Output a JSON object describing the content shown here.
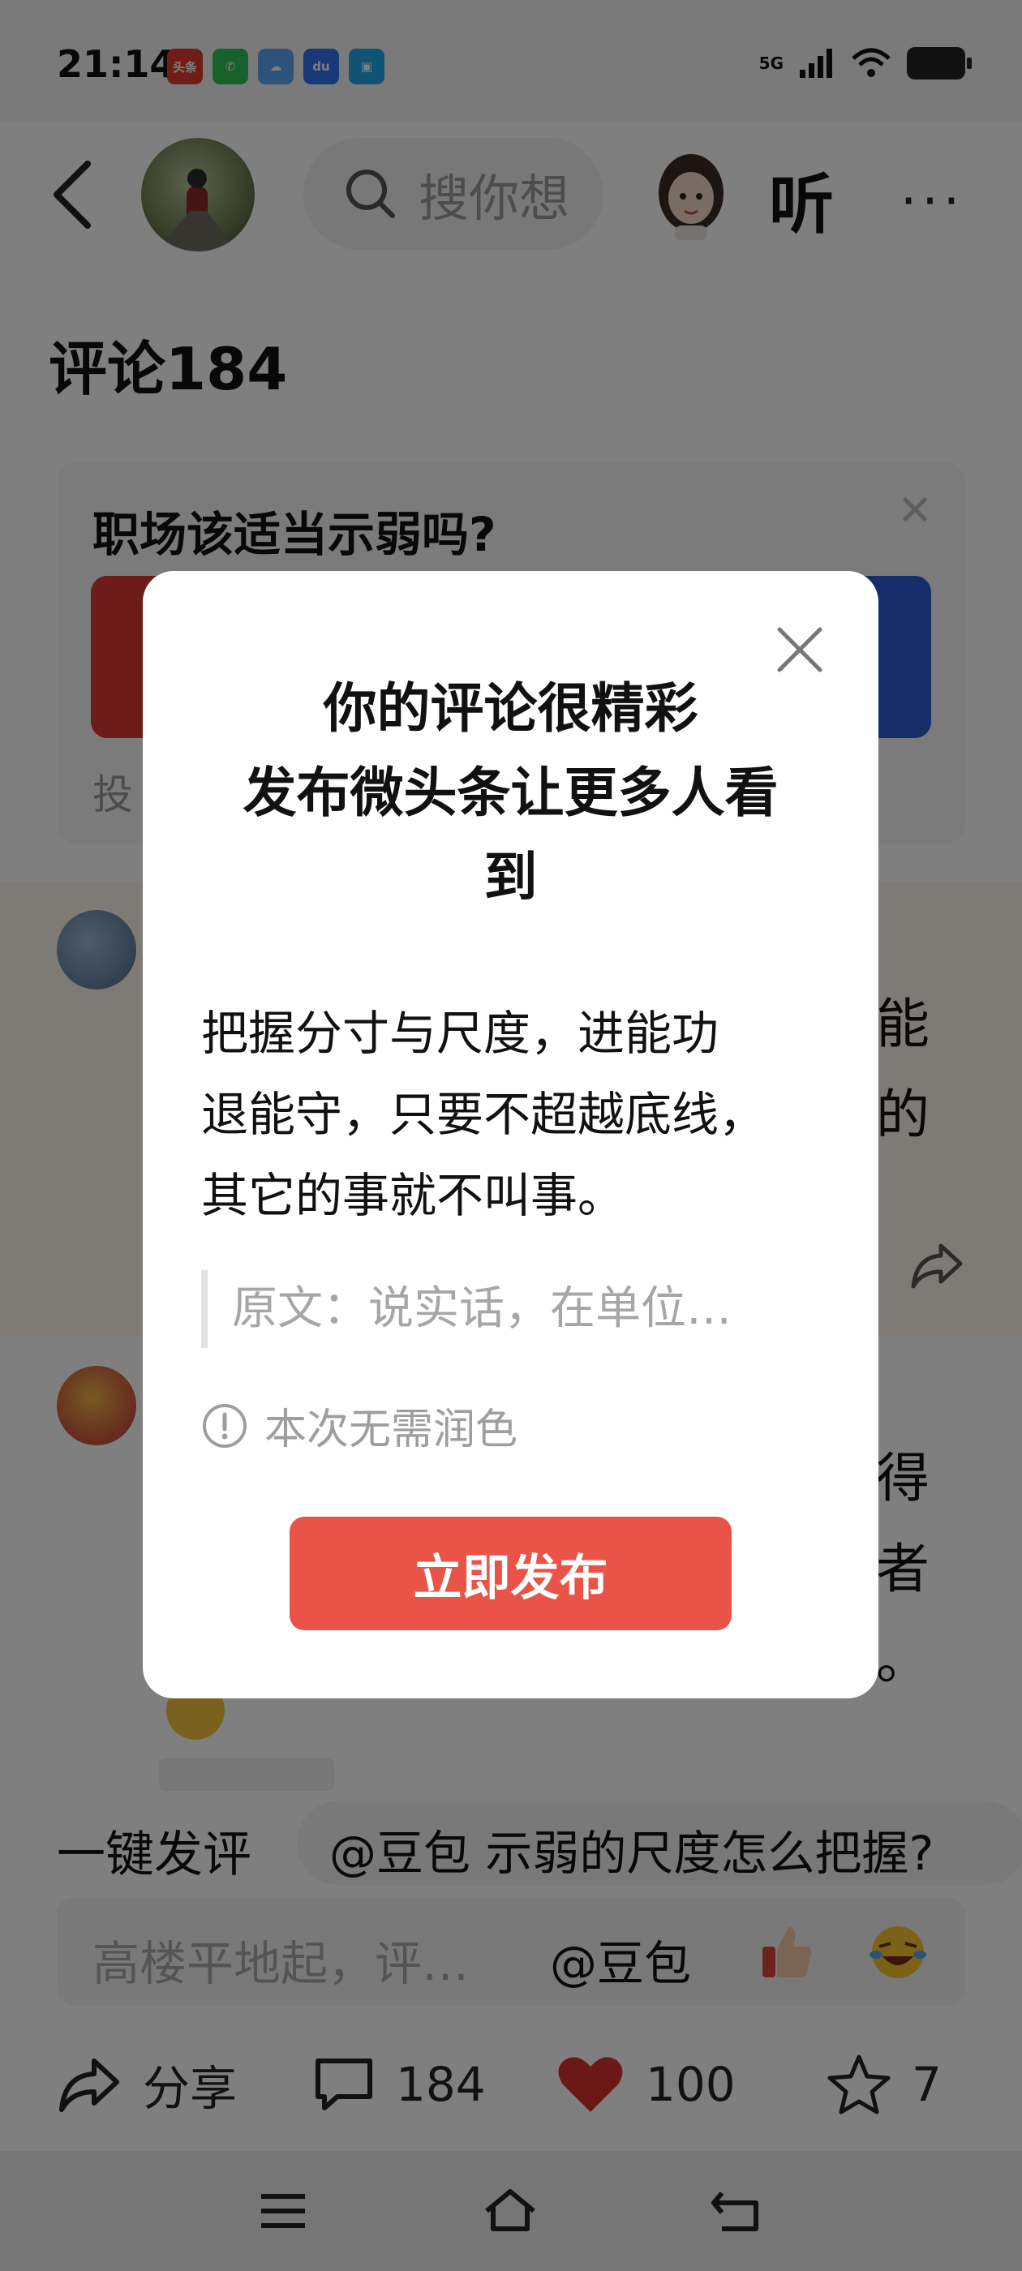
{
  "status_bar": {
    "time": "21:14",
    "network": "5G",
    "app_icons": [
      "toutiao",
      "phone",
      "weather",
      "baidu",
      "files"
    ],
    "toutiao_label": "头条"
  },
  "nav": {
    "search_placeholder": "搜你想",
    "listen_label": "听",
    "more_label": "···"
  },
  "page": {
    "title": "评论184"
  },
  "poll": {
    "title": "职场该适当示弱吗?",
    "footer_prefix": "投"
  },
  "comments": [
    {
      "visible_tail": [
        "能",
        "的"
      ]
    },
    {
      "visible_tail": [
        "得",
        "者",
        "。"
      ]
    }
  ],
  "bottom": {
    "quick_label": "一键发评",
    "quick_prompt": "@豆包 示弱的尺度怎么把握?",
    "composer_placeholder": "高楼平地起，评…",
    "composer_mention": "@豆包"
  },
  "actions": {
    "share_label": "分享",
    "comments_count": "184",
    "likes_count": "100",
    "favorites_count": "7"
  },
  "modal": {
    "title_line1": "你的评论很精彩",
    "title_line2": "发布微头条让更多人看",
    "title_line3": "到",
    "body_line1": "把握分寸与尺度，进能功",
    "body_line2": "退能守，只要不超越底线，",
    "body_line3": "其它的事就不叫事。",
    "quote": "原文：说实话，在单位…",
    "hint": "本次无需润色",
    "publish_label": "立即发布"
  },
  "colors": {
    "publish_button": "#ea5448",
    "poll_red": "#d93a33",
    "poll_blue": "#2e5ad4",
    "like_red": "#d9302c"
  }
}
